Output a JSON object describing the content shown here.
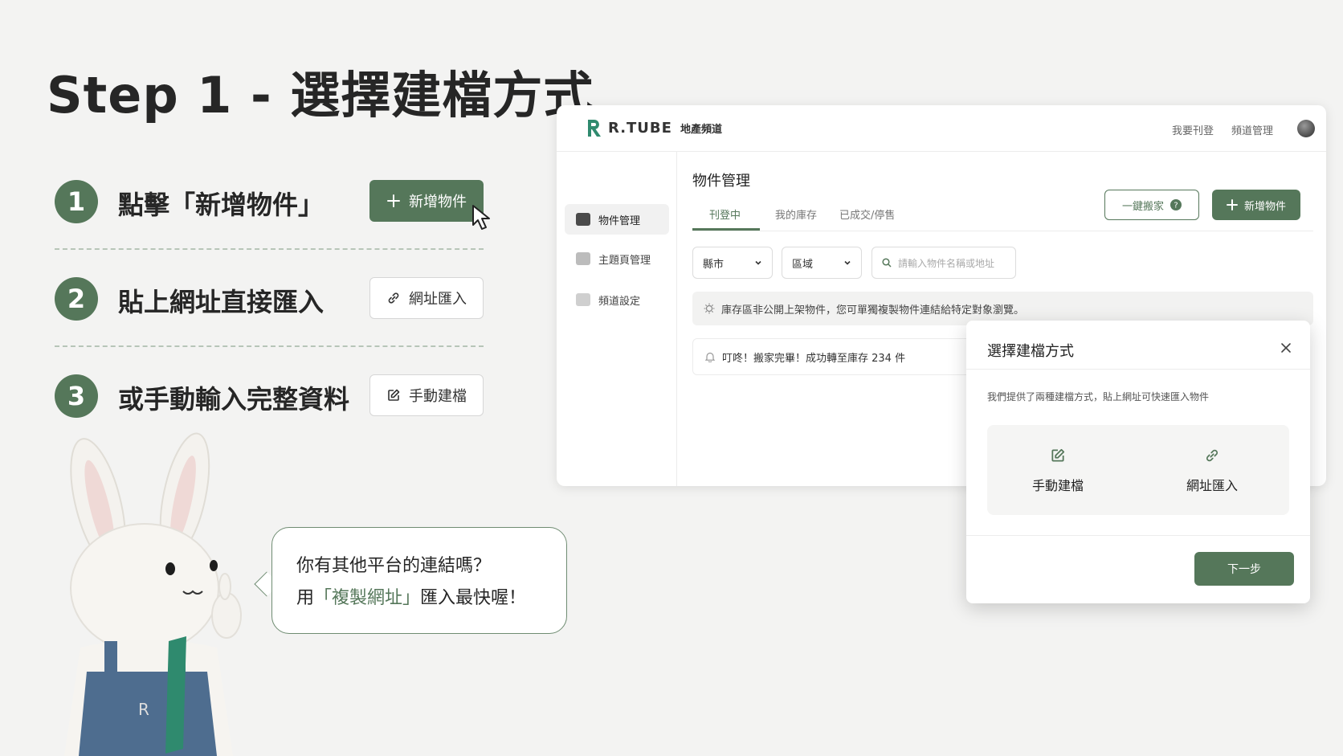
{
  "title": "Step 1 - 選擇建檔方式",
  "colors": {
    "brand_green": "#55775a",
    "background": "#f3f3f2"
  },
  "steps": [
    {
      "num": "1",
      "text": "點擊「新增物件」",
      "button": "新增物件",
      "button_icon": "plus-icon"
    },
    {
      "num": "2",
      "text": "貼上網址直接匯入",
      "button": "網址匯入",
      "button_icon": "link-icon"
    },
    {
      "num": "3",
      "text": "或手動輸入完整資料",
      "button": "手動建檔",
      "button_icon": "edit-icon"
    }
  ],
  "bubble": {
    "line1": "你有其他平台的連結嗎？",
    "line2_pre": "用",
    "line2_highlight": "「複製網址」",
    "line2_post": "匯入最快喔！"
  },
  "app": {
    "logo_word": "R.TUBE",
    "logo_sub": "地產頻道",
    "header_links": [
      "我要刊登",
      "頻道管理"
    ],
    "sidebar": [
      "物件管理",
      "主題頁管理",
      "頻道設定"
    ],
    "page_title": "物件管理",
    "tabs": [
      "刊登中",
      "我的庫存",
      "已成交/停售"
    ],
    "btn_move": "一鍵搬家",
    "btn_add": "新增物件",
    "filter_city": "縣市",
    "filter_area": "區域",
    "search_placeholder": "請輸入物件名稱或地址",
    "notice": "庫存區非公開上架物件，您可單獨複製物件連結給特定對象瀏覽。",
    "toast": "叮咚！搬家完畢！成功轉至庫存 234 件"
  },
  "modal": {
    "title": "選擇建檔方式",
    "desc": "我們提供了兩種建檔方式，貼上網址可快速匯入物件",
    "option_manual": "手動建檔",
    "option_url": "網址匯入",
    "next": "下一步"
  }
}
